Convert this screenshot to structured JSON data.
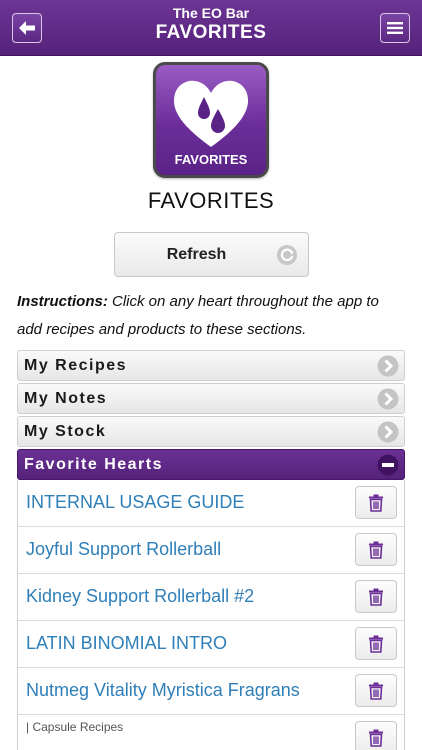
{
  "header": {
    "app_name": "The EO Bar",
    "title": "FAVORITES",
    "back_icon": "back-arrow-icon",
    "menu_icon": "hamburger-menu-icon"
  },
  "hero": {
    "icon": "heart-drops-icon",
    "label": "FAVORITES"
  },
  "section_title": "FAVORITES",
  "refresh": {
    "label": "Refresh",
    "icon": "refresh-icon"
  },
  "instructions": {
    "lead": "Instructions:",
    "text": " Click on any heart throughout the app to add recipes and products to these sections."
  },
  "accordion": [
    {
      "label": "My Recipes",
      "icon": "chevron-right-circle-icon"
    },
    {
      "label": "My Notes",
      "icon": "chevron-right-circle-icon"
    },
    {
      "label": "My Stock",
      "icon": "chevron-right-circle-icon"
    },
    {
      "label": "Favorite Hearts",
      "icon": "minus-circle-icon",
      "expanded": true
    }
  ],
  "favorites": [
    {
      "title": "INTERNAL USAGE GUIDE"
    },
    {
      "title": "Joyful Support Rollerball"
    },
    {
      "title": "Kidney Support Rollerball #2"
    },
    {
      "title": "LATIN BINOMIAL INTRO"
    },
    {
      "title": "Nutmeg Vitality Myristica Fragrans"
    },
    {
      "title": "| Capsule Recipes"
    }
  ],
  "colors": {
    "brand_purple": "#5b2882",
    "link_blue": "#2f7fb8",
    "trash_purple": "#6b2e99"
  }
}
